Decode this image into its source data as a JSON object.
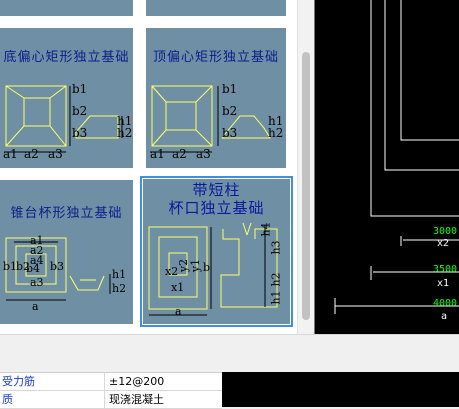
{
  "gallery": {
    "items": [
      {
        "title": "底偏心矩形独立基础",
        "dims": [
          "b1",
          "b2",
          "b3",
          "h1",
          "h2",
          "a1",
          "a2",
          "a3"
        ]
      },
      {
        "title": "顶偏心矩形独立基础",
        "dims": [
          "b1",
          "b2",
          "b3",
          "h1",
          "h2",
          "a1",
          "a2",
          "a3"
        ]
      },
      {
        "title": "锥台杯形独立基础",
        "dims": [
          "a1",
          "a2",
          "a3",
          "a4",
          "b1",
          "b2",
          "b3",
          "b4",
          "h1",
          "h2",
          "a"
        ]
      },
      {
        "title_line1": "带短柱",
        "title_line2": "杯口独立基础",
        "dims": [
          "x2",
          "y2",
          "y1",
          "x1",
          "b",
          "a",
          "h4",
          "h3",
          "h2",
          "h1"
        ]
      }
    ]
  },
  "cad": {
    "labels": [
      "3000",
      "x2",
      "3500",
      "x1",
      "4000",
      "a"
    ],
    "colors": {
      "background": "#000000",
      "line": "#ffffff",
      "dimension_text": "#00ff00"
    }
  },
  "properties": {
    "rows": [
      {
        "name": "受力筋",
        "value": "±12@200"
      },
      {
        "name": "质",
        "value": "现浇混凝土"
      }
    ]
  },
  "colors": {
    "tile": "#6f8fa4",
    "tile_title": "#0a1e8c",
    "drawing": "#ffff66",
    "selection": "#3e8fe0"
  }
}
